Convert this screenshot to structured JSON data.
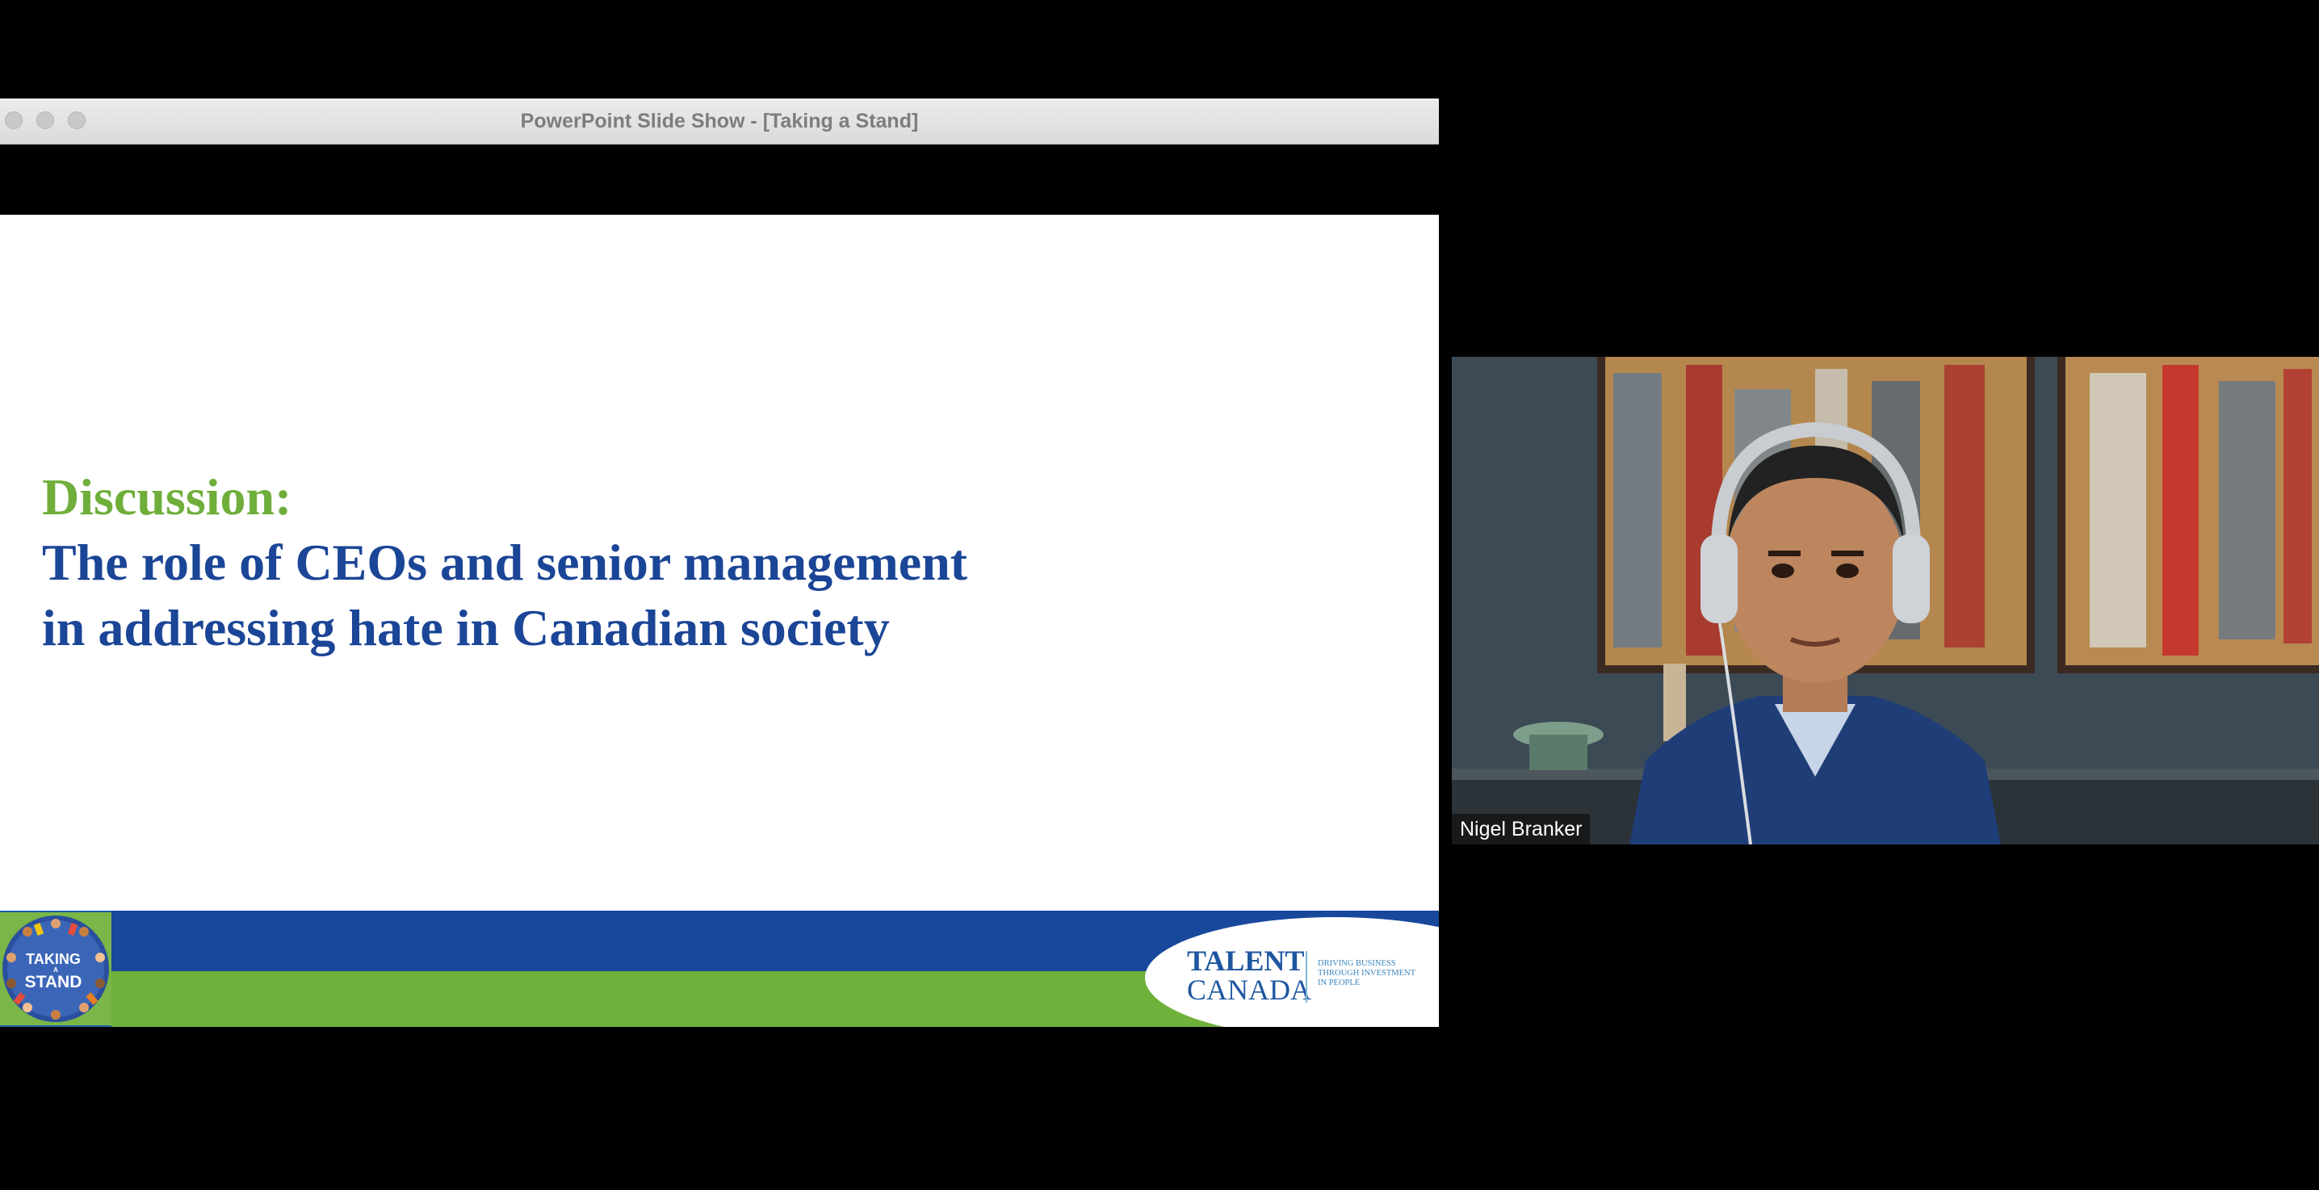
{
  "window": {
    "title": "PowerPoint Slide Show - [Taking a Stand]"
  },
  "slide": {
    "heading": "Discussion:",
    "title_lines": [
      "The role of CEOs and senior management",
      "in addressing hate in Canadian society"
    ],
    "badge": {
      "line1": "TAKING",
      "line2": "A",
      "line3": "STAND"
    },
    "logo": {
      "brand_top": "TALENT",
      "brand_bottom": "CANADA",
      "tagline_lines": [
        "Driving business",
        "through investment",
        "in people"
      ]
    },
    "colors": {
      "green": "#6fae3a",
      "blue": "#1b4596"
    }
  },
  "participant": {
    "name": "Nigel Branker"
  }
}
